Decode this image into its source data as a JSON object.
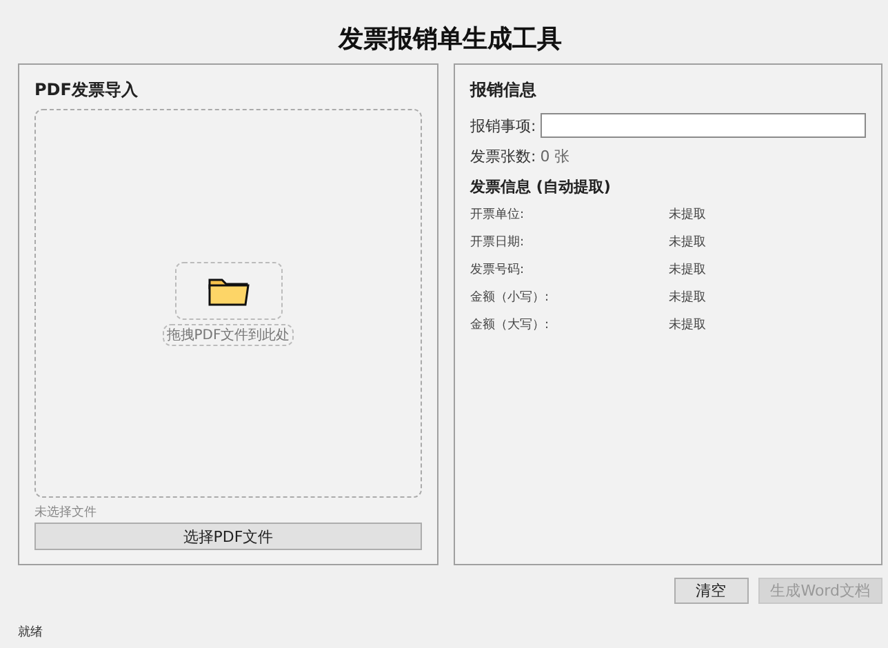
{
  "window": {
    "title": "发票报销单生成工具"
  },
  "import_panel": {
    "title": "PDF发票导入",
    "drop_hint": "拖拽PDF文件到此处",
    "file_status": "未选择文件",
    "select_button": "选择PDF文件"
  },
  "info_panel": {
    "title": "报销信息",
    "purpose_label": "报销事项:",
    "count_label": "发票张数:",
    "count_value": "0 张",
    "section_title": "发票信息 (自动提取)",
    "fields": [
      {
        "label": "开票单位:",
        "value": "未提取"
      },
      {
        "label": "开票日期:",
        "value": "未提取"
      },
      {
        "label": "发票号码:",
        "value": "未提取"
      },
      {
        "label": "金额（小写）:",
        "value": "未提取"
      },
      {
        "label": "金额（大写）:",
        "value": "未提取"
      }
    ]
  },
  "buttons": [
    {
      "label": "清空",
      "disabled": false
    },
    {
      "label": "生成Word文档",
      "disabled": true
    }
  ],
  "status_bar": "就绪"
}
